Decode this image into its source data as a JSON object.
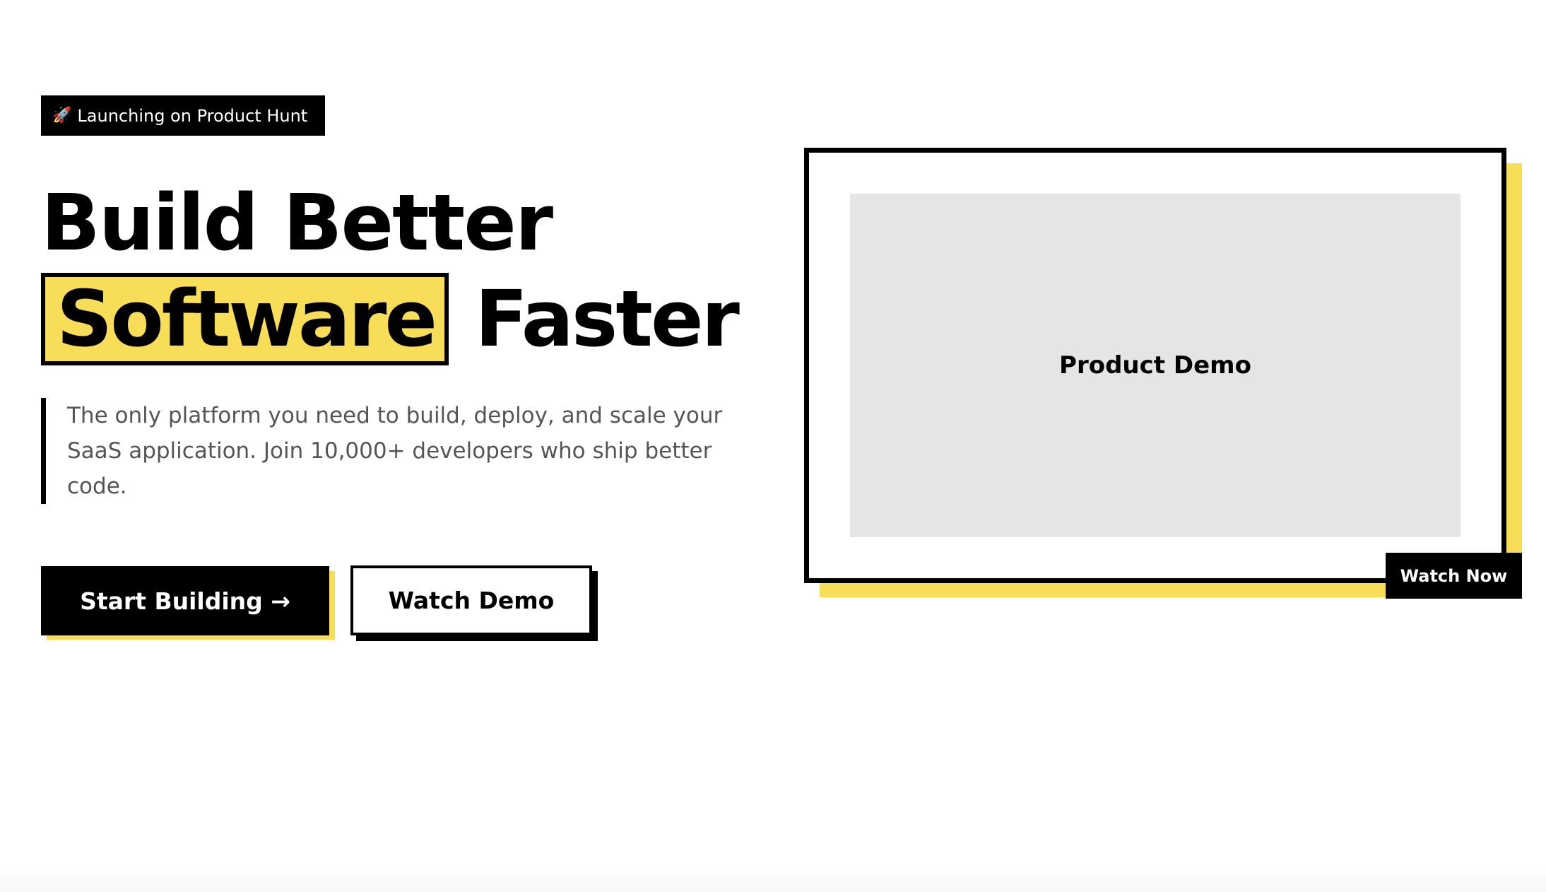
{
  "badge": {
    "icon": "rocket-icon",
    "icon_glyph": "🚀",
    "label": "Launching on Product Hunt"
  },
  "headline": {
    "line1": "Build Better",
    "highlight": "Software",
    "line2_rest": "Faster"
  },
  "description": "The only platform you need to build, deploy, and scale your SaaS application. Join 10,000+ developers who ship better code.",
  "buttons": {
    "primary": "Start Building →",
    "secondary": "Watch Demo"
  },
  "demo_card": {
    "placeholder_label": "Product Demo",
    "watch_now_label": "Watch Now"
  },
  "colors": {
    "accent_yellow": "#f8dd58",
    "black": "#000000",
    "body_text_gray": "#555555",
    "placeholder_gray": "#e5e5e5"
  }
}
